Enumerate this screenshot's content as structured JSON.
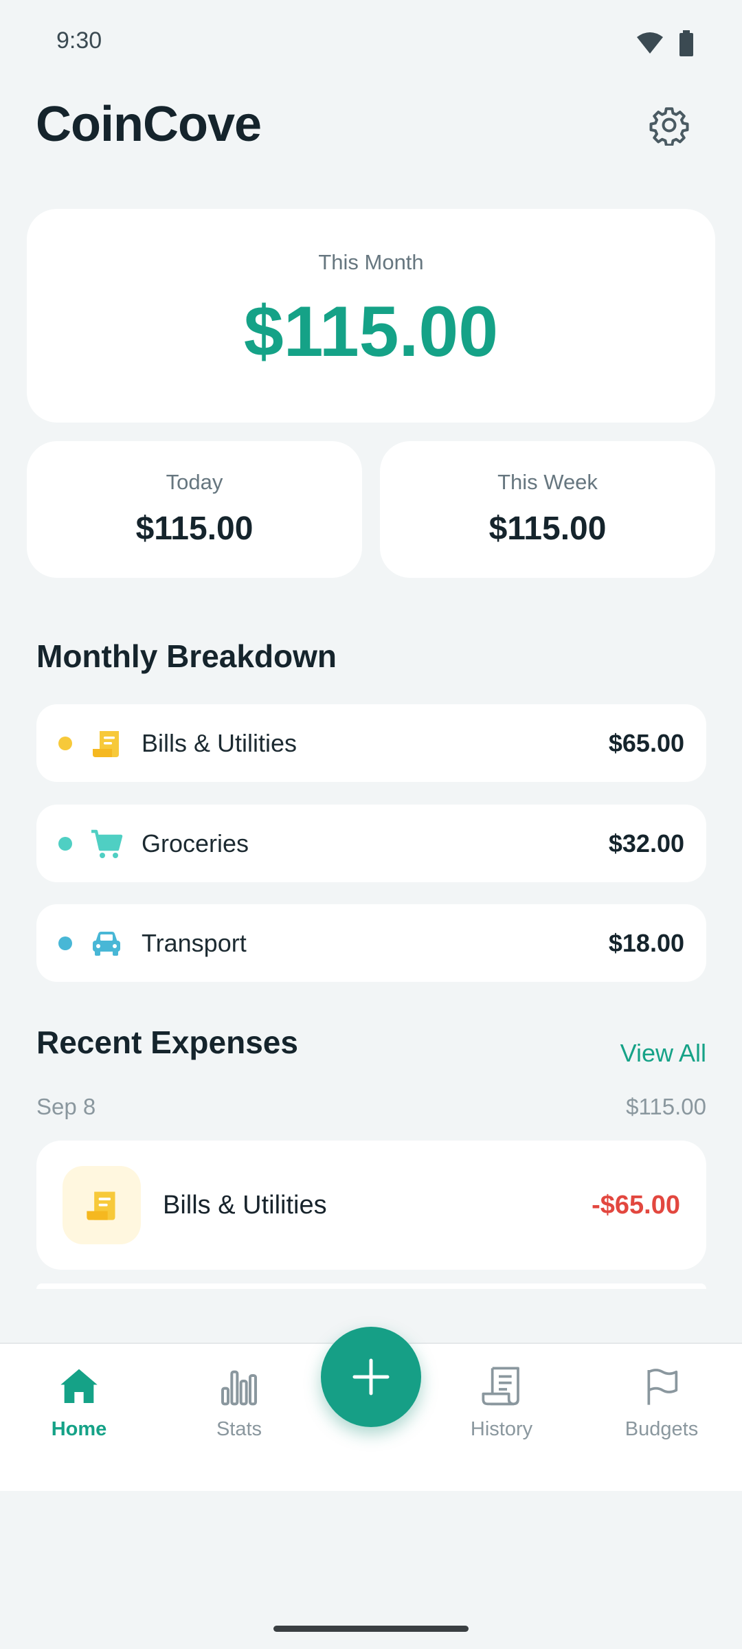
{
  "status_bar": {
    "time": "9:30"
  },
  "header": {
    "title": "CoinCove"
  },
  "summary": {
    "month_label": "This Month",
    "month_value": "$115.00",
    "today_label": "Today",
    "today_value": "$115.00",
    "week_label": "This Week",
    "week_value": "$115.00"
  },
  "breakdown": {
    "title": "Monthly Breakdown",
    "items": [
      {
        "name": "Bills & Utilities",
        "amount": "$65.00",
        "color": "#f7c93a",
        "icon": "receipt-icon"
      },
      {
        "name": "Groceries",
        "amount": "$32.00",
        "color": "#4fcfc3",
        "icon": "cart-icon"
      },
      {
        "name": "Transport",
        "amount": "$18.00",
        "color": "#48b7d6",
        "icon": "car-icon"
      }
    ]
  },
  "recent": {
    "title": "Recent Expenses",
    "view_all": "View All",
    "date": "Sep 8",
    "date_total": "$115.00",
    "items": [
      {
        "name": "Bills & Utilities",
        "amount": "-$65.00",
        "icon": "receipt-icon"
      }
    ]
  },
  "nav": {
    "home": "Home",
    "stats": "Stats",
    "history": "History",
    "budgets": "Budgets"
  },
  "colors": {
    "accent": "#15a287",
    "negative": "#e2473f"
  }
}
